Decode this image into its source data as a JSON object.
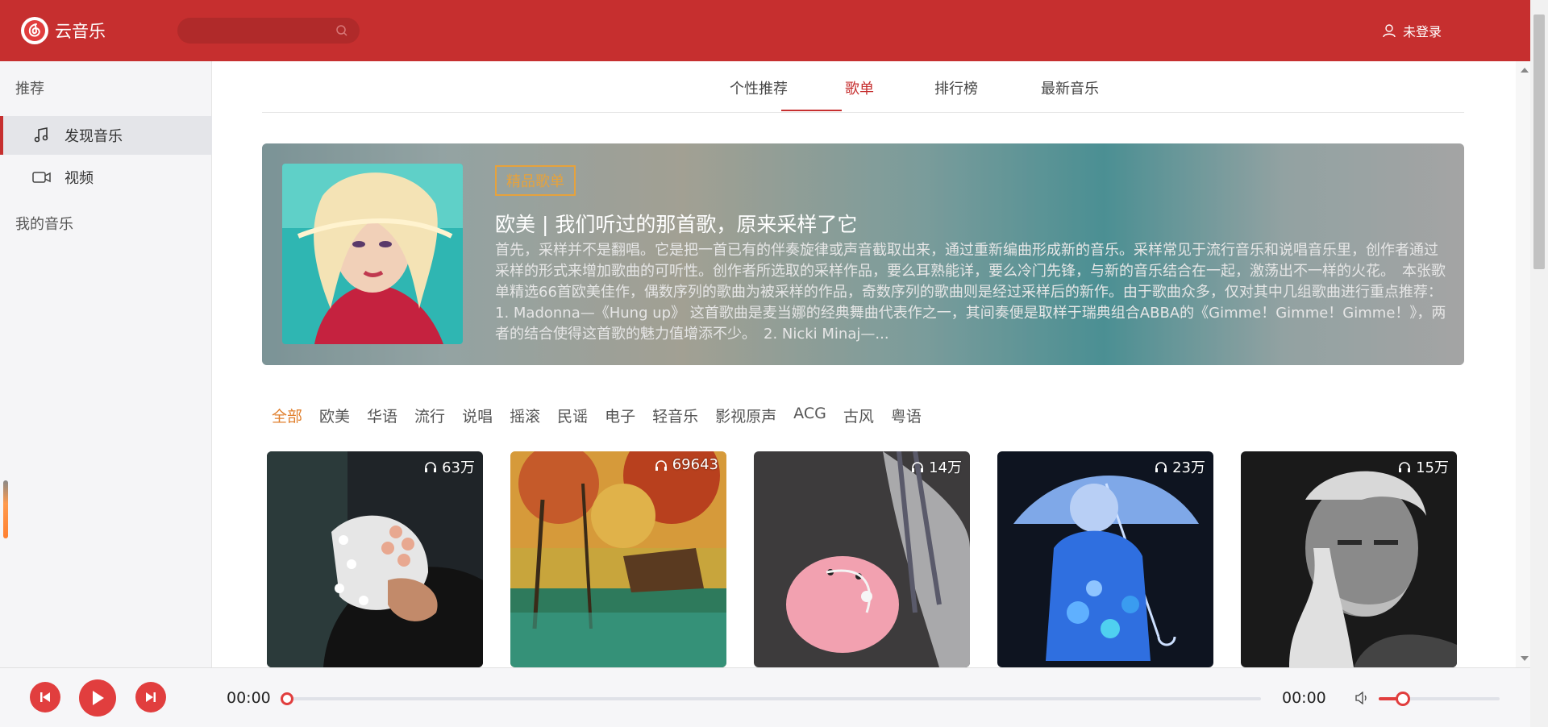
{
  "app": {
    "name": "云音乐"
  },
  "header": {
    "search_placeholder": "",
    "login_label": "未登录"
  },
  "sidebar": {
    "section_recommend": "推荐",
    "items": [
      {
        "label": "发现音乐",
        "icon": "music-note-icon",
        "active": true
      },
      {
        "label": "视频",
        "icon": "video-camera-icon",
        "active": false
      }
    ],
    "section_my_music": "我的音乐"
  },
  "tabs": [
    {
      "label": "个性推荐",
      "active": false
    },
    {
      "label": "歌单",
      "active": true
    },
    {
      "label": "排行榜",
      "active": false
    },
    {
      "label": "最新音乐",
      "active": false
    }
  ],
  "banner": {
    "tag": "精品歌单",
    "title": "欧美 | 我们听过的那首歌，原来采样了它",
    "description": "首先，采样并不是翻唱。它是把一首已有的伴奏旋律或声音截取出来，通过重新编曲形成新的音乐。采样常见于流行音乐和说唱音乐里，创作者通过采样的形式来增加歌曲的可听性。创作者所选取的采样作品，要么耳熟能详，要么冷门先锋，与新的音乐结合在一起，激荡出不一样的火花。　本张歌单精选66首欧美佳作，偶数序列的歌曲为被采样的作品，奇数序列的歌曲则是经过采样后的新作。由于歌曲众多，仅对其中几组歌曲进行重点推荐：　1. Madonna—《Hung up》 这首歌曲是麦当娜的经典舞曲代表作之一，其间奏便是取样于瑞典组合ABBA的《Gimme！Gimme！Gimme！》，两者的结合使得这首歌的魅力值增添不少。　2. Nicki Minaj—..."
  },
  "categories": [
    {
      "label": "全部",
      "active": true
    },
    {
      "label": "欧美"
    },
    {
      "label": "华语"
    },
    {
      "label": "流行"
    },
    {
      "label": "说唱"
    },
    {
      "label": "摇滚"
    },
    {
      "label": "民谣"
    },
    {
      "label": "电子"
    },
    {
      "label": "轻音乐"
    },
    {
      "label": "影视原声"
    },
    {
      "label": "ACG"
    },
    {
      "label": "古风"
    },
    {
      "label": "粤语"
    }
  ],
  "playlists": [
    {
      "play_count": "63万"
    },
    {
      "play_count": "69643"
    },
    {
      "play_count": "14万"
    },
    {
      "play_count": "23万"
    },
    {
      "play_count": "15万"
    }
  ],
  "player": {
    "current_time": "00:00",
    "total_time": "00:00",
    "progress": 0,
    "volume": 0.2
  },
  "colors": {
    "brand": "#c62f2f",
    "accent": "#e13e3e",
    "category_active": "#e07f2c",
    "tag": "#e6a23c"
  }
}
